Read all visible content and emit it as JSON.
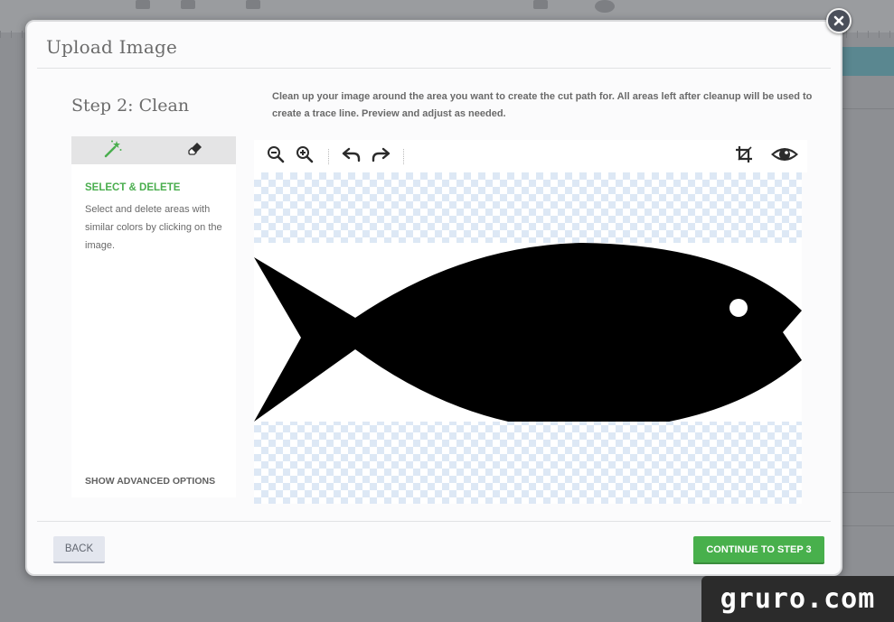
{
  "modal": {
    "title": "Upload Image",
    "step_title": "Step 2: Clean",
    "instructions": "Clean up your image around the area you want to create the cut path for. All areas left after cleanup will be used to create a trace line. Preview and adjust as needed."
  },
  "tools": {
    "tabs": [
      {
        "icon": "magic-wand-icon",
        "active": true
      },
      {
        "icon": "eraser-icon",
        "active": false
      }
    ],
    "heading": "SELECT & DELETE",
    "description": "Select and delete areas with similar colors by clicking on the image.",
    "advanced_link": "SHOW ADVANCED OPTIONS"
  },
  "canvas_toolbar": {
    "buttons": [
      "zoom-out-icon",
      "zoom-in-icon",
      "undo-icon",
      "redo-icon",
      "crop-icon",
      "preview-eye-icon"
    ]
  },
  "footer": {
    "back_label": "BACK",
    "continue_label": "CONTINUE TO STEP 3"
  },
  "watermark": "gruro.com",
  "colors": {
    "accent_green": "#48b04c",
    "heading_green": "#4aae4e",
    "checker_blue": "#dde8f5",
    "close_button": "#4a4f5a"
  }
}
